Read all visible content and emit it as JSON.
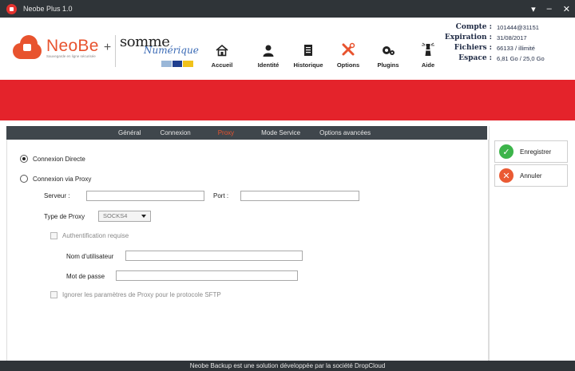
{
  "window": {
    "title": "Neobe Plus 1.0",
    "controls": [
      "▾",
      "–",
      "✕"
    ]
  },
  "logo": {
    "brand": "NeoBe",
    "plus": "+",
    "tagline": "Sauvegarde en ligne sécurisée"
  },
  "partner": {
    "line1": "somme",
    "line2": "Numérique"
  },
  "nav": {
    "accueil": "Accueil",
    "identite": "Identité",
    "historique": "Historique",
    "options": "Options",
    "plugins": "Plugins",
    "aide": "Aide"
  },
  "account": {
    "compte_label": "Compte :",
    "compte_value": "101444@31151",
    "expiration_label": "Expiration :",
    "expiration_value": "31/08/2017",
    "fichiers_label": "Fichiers :",
    "fichiers_value": "66133 / illimité",
    "espace_label": "Espace :",
    "espace_value": "6,81 Go / 25,0 Go"
  },
  "tabs": [
    "Général",
    "Connexion",
    "Proxy",
    "Mode Service",
    "Options avancées"
  ],
  "active_tab": "Proxy",
  "form": {
    "direct_label": "Connexion Directe",
    "proxy_label": "Connexion via Proxy",
    "selected_mode": "direct",
    "serveur_label": "Serveur :",
    "serveur_value": "",
    "port_label": "Port :",
    "port_value": "",
    "type_label": "Type de Proxy",
    "type_value": "SOCKS4",
    "auth_label": "Authentification requise",
    "user_label": "Nom d'utilisateur",
    "user_value": "",
    "pass_label": "Mot de passe",
    "pass_value": "",
    "sftp_label": "Ignorer les paramètres de Proxy pour le protocole SFTP"
  },
  "side": {
    "save_label": "Enregistrer",
    "cancel_label": "Annuler"
  },
  "footer": {
    "text": "Neobe Backup est une solution développée par la société DropCloud"
  },
  "colors": {
    "accent": "#e8532e",
    "red_band": "#e4232b",
    "dark": "#2f3438",
    "save_green": "#3cb44a",
    "cancel_orange": "#ea5a33"
  }
}
